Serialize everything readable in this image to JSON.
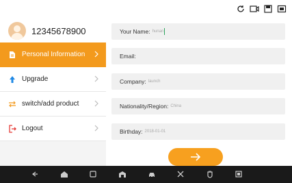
{
  "user": {
    "name": "12345678900"
  },
  "menu": [
    {
      "label": "Personal Information",
      "icon": "document-icon",
      "active": true
    },
    {
      "label": "Upgrade",
      "icon": "upload-arrow-icon",
      "active": false
    },
    {
      "label": "switch/add product",
      "icon": "swap-arrows-icon",
      "active": false
    },
    {
      "label": "Logout",
      "icon": "logout-icon",
      "active": false
    }
  ],
  "form": {
    "fields": [
      {
        "label": "Your Name:",
        "value": "hunan"
      },
      {
        "label": "Email:",
        "value": ""
      },
      {
        "label": "Company:",
        "value": "launch"
      },
      {
        "label": "Nationality/Region:",
        "value": "China"
      },
      {
        "label": "Birthday:",
        "value": "2018-01-01"
      }
    ]
  },
  "top_icons": [
    "refresh-icon",
    "video-icon",
    "save-icon",
    "screenshot-icon"
  ],
  "colors": {
    "accent": "#f39a1d",
    "navbar": "#1a1a1a",
    "sidebar": "#f4f4f4",
    "field_bg": "#f0f0f0"
  }
}
